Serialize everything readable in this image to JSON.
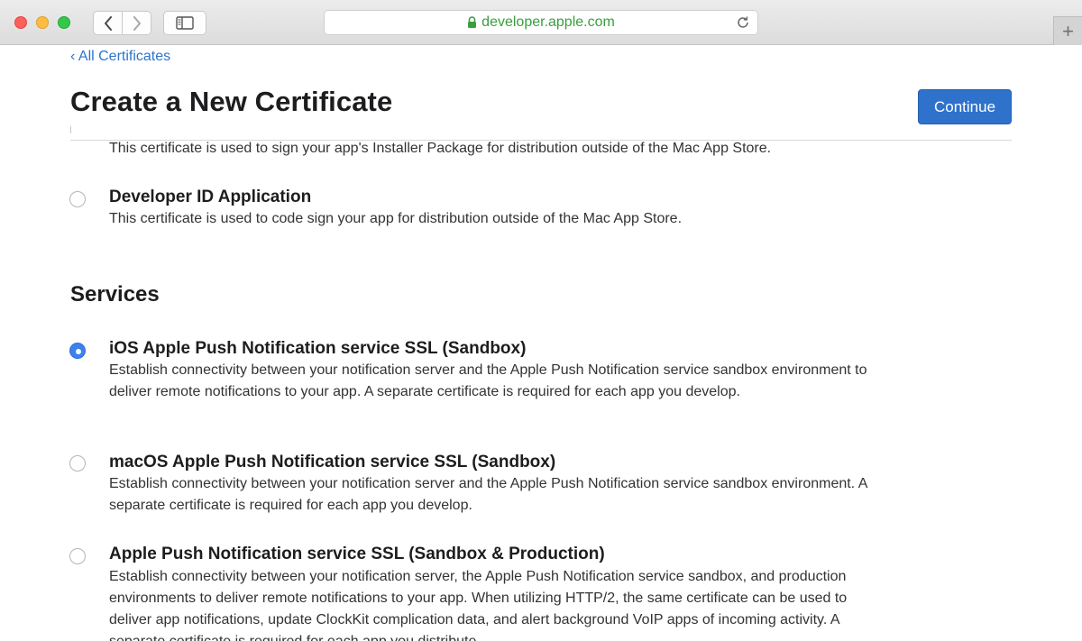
{
  "browser": {
    "url": "developer.apple.com",
    "new_tab_symbol": "+"
  },
  "page": {
    "back_link": "All Certificates",
    "back_chevron": "‹",
    "title": "Create a New Certificate",
    "continue_label": "Continue"
  },
  "options_top": {
    "partial_desc": "This certificate is used to sign your app's Installer Package for distribution outside of the Mac App Store.",
    "developer_id_app": {
      "title": "Developer ID Application",
      "desc": "This certificate is used to code sign your app for distribution outside of the Mac App Store.",
      "selected": false
    }
  },
  "services": {
    "heading": "Services",
    "items": [
      {
        "title": "iOS Apple Push Notification service SSL (Sandbox)",
        "desc": "Establish connectivity between your notification server and the Apple Push Notification service sandbox environment to deliver remote notifications to your app. A separate certificate is required for each app you develop.",
        "selected": true
      },
      {
        "title": "macOS Apple Push Notification service SSL (Sandbox)",
        "desc": "Establish connectivity between your notification server and the Apple Push Notification service sandbox environment. A separate certificate is required for each app you develop.",
        "selected": false
      },
      {
        "title": "Apple Push Notification service SSL (Sandbox & Production)",
        "desc": "Establish connectivity between your notification server, the Apple Push Notification service sandbox, and production environments to deliver remote notifications to your app. When utilizing HTTP/2, the same certificate can be used to deliver app notifications, update ClockKit complication data, and alert background VoIP apps of incoming activity. A separate certificate is required for each app you distribute.",
        "selected": false
      }
    ]
  },
  "colors": {
    "link": "#2d74cf",
    "button": "#2f72cb",
    "radio_selected": "#3b82f0",
    "url_green": "#3a9e3f"
  }
}
